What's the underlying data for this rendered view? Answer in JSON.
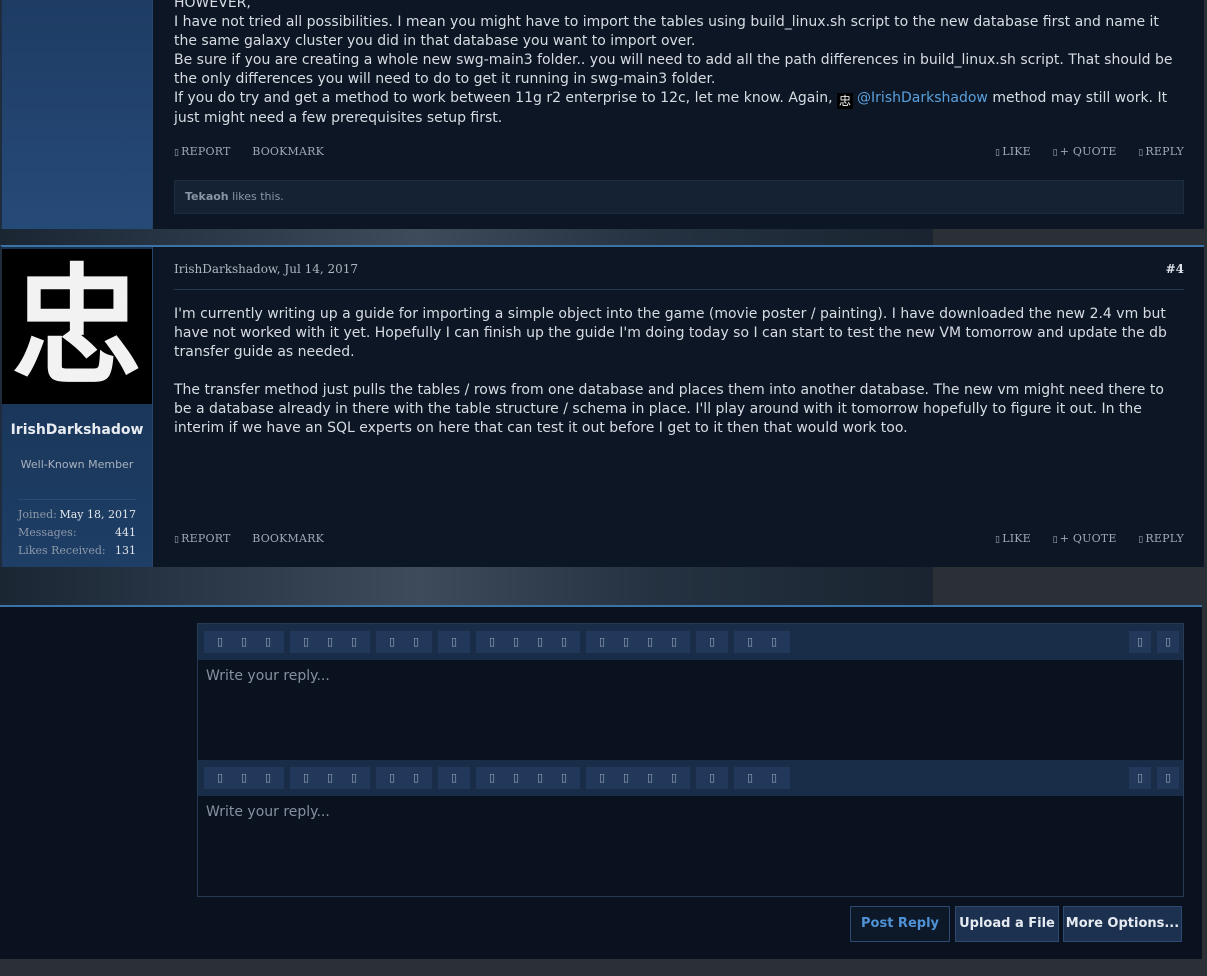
{
  "post3": {
    "lines": [
      "HOWEVER,",
      "I have not tried all possibilities. I mean you might have to import the tables using build_linux.sh script to the new database first and name it the same galaxy cluster you did in that database you want to import over.",
      "Be sure if you are creating a whole new swg-main3 folder.. you will need to add all the path differences in build_linux.sh script. That should be the only differences you will need to do to get it running in swg-main3 folder."
    ],
    "last_line_before": "If you do try and get a method to work between 11g r2 enterprise to 12c, let me know. Again,",
    "mention": "@IrishDarkshadow",
    "last_line_after": "method may still work. It just might need a few prerequisites setup first.",
    "avatar_glyph": "忠",
    "likes_user": "Tekaoh",
    "likes_suffix": "likes this."
  },
  "actions": {
    "report": "REPORT",
    "bookmark": "BOOKMARK",
    "like": "LIKE",
    "quote": "+ QUOTE",
    "reply": "REPLY",
    "glyph": "▯"
  },
  "post4": {
    "avatar_glyph": "忠",
    "username": "IrishDarkshadow",
    "user_title": "Well-Known Member",
    "stats": [
      {
        "label": "Joined:",
        "value": "May 18, 2017"
      },
      {
        "label": "Messages:",
        "value": "441"
      },
      {
        "label": "Likes Received:",
        "value": "131"
      }
    ],
    "author_date": "IrishDarkshadow, Jul 14, 2017",
    "post_number": "#4",
    "paragraph1": "I'm currently writing up a guide for importing a simple object into the game (movie poster / painting). I have downloaded the new 2.4 vm but have not worked with it yet. Hopefully I can finish up the guide I'm doing today so I can start to test the new VM tomorrow and update the db transfer guide as needed.",
    "paragraph2": "The transfer method just pulls the tables / rows from one database and places them into another database. The new vm might need there to be a database already in there with the table structure / schema in place. I'll play around with it tomorrow hopefully to figure it out. In the interim if we have an SQL experts on here that can test it out before I get to it then that would work too."
  },
  "editor": {
    "placeholder": "Write your reply...",
    "tool_glyph": "▯",
    "post_reply": "Post Reply",
    "upload_file": "Upload a File",
    "more_options": "More Options..."
  }
}
